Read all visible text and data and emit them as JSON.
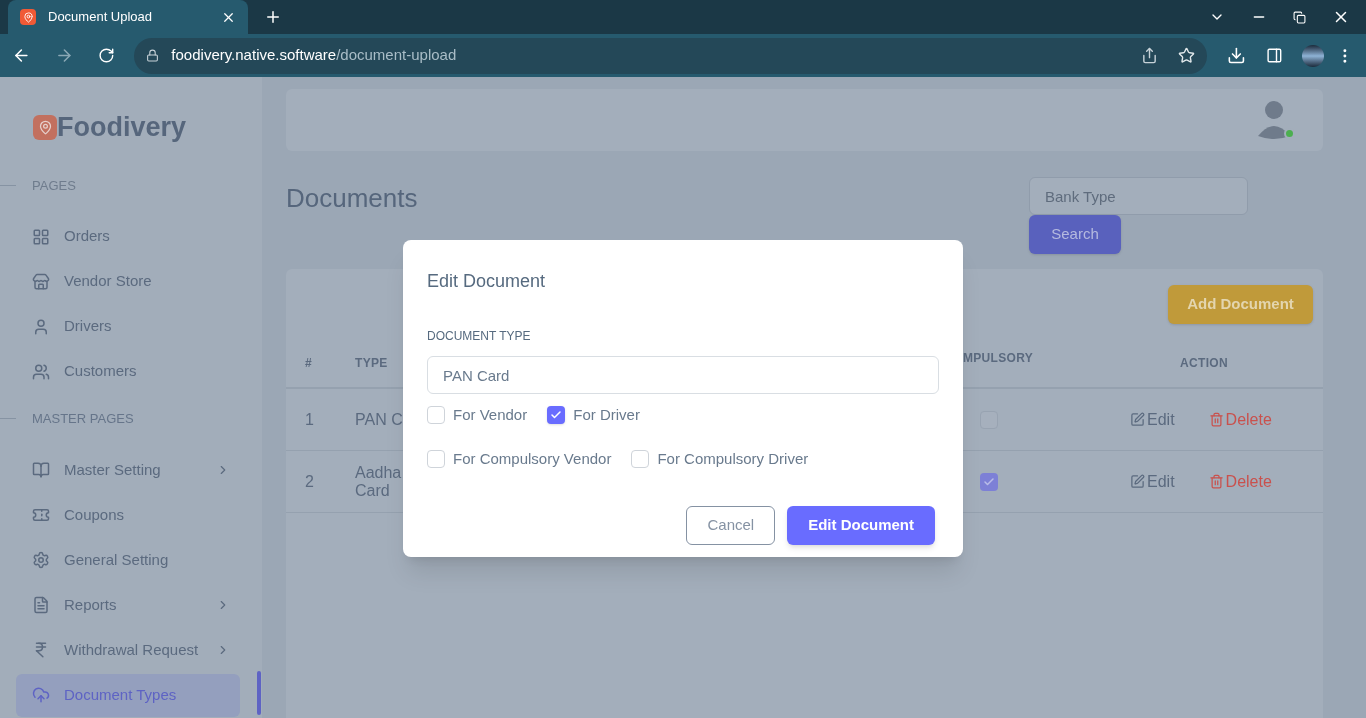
{
  "browser": {
    "tab_title": "Document Upload",
    "url_host": "foodivery.native.software",
    "url_path": "/document-upload"
  },
  "sidebar": {
    "brand": "Foodivery",
    "sections": [
      {
        "heading": "PAGES",
        "items": [
          {
            "label": "Orders",
            "selected": false,
            "expandable": false
          },
          {
            "label": "Vendor Store",
            "selected": false,
            "expandable": false
          },
          {
            "label": "Drivers",
            "selected": false,
            "expandable": false
          },
          {
            "label": "Customers",
            "selected": false,
            "expandable": false
          }
        ]
      },
      {
        "heading": "MASTER PAGES",
        "items": [
          {
            "label": "Master Setting",
            "selected": false,
            "expandable": true
          },
          {
            "label": "Coupons",
            "selected": false,
            "expandable": false
          },
          {
            "label": "General Setting",
            "selected": false,
            "expandable": false
          },
          {
            "label": "Reports",
            "selected": false,
            "expandable": true
          },
          {
            "label": "Withdrawal Request",
            "selected": false,
            "expandable": true
          },
          {
            "label": "Document Types",
            "selected": true,
            "expandable": false
          }
        ]
      }
    ]
  },
  "header": {
    "avatar_online": true
  },
  "page": {
    "title": "Documents",
    "search": {
      "placeholder": "Bank Type",
      "button": "Search"
    },
    "add_button": "Add Document"
  },
  "table": {
    "columns": [
      "#",
      "TYPE",
      "MPULSORY",
      "ACTION"
    ],
    "rows": [
      {
        "number": "1",
        "type": "PAN C",
        "checked": false,
        "actions": [
          "Edit",
          "Delete"
        ]
      },
      {
        "number": "2",
        "type": "Aadha Card",
        "checked": true,
        "actions": [
          "Edit",
          "Delete"
        ]
      }
    ]
  },
  "modal": {
    "title": "Edit Document",
    "field_label": "DOCUMENT TYPE",
    "field_value": "PAN Card",
    "option_rows": [
      [
        {
          "label": "For Vendor",
          "checked": false
        },
        {
          "label": "For Driver",
          "checked": true
        }
      ],
      [
        {
          "label": "For Compulsory Vendor",
          "checked": false
        },
        {
          "label": "For Compulsory Driver",
          "checked": false
        }
      ]
    ],
    "buttons": [
      {
        "label": "Cancel",
        "kind": "secondary"
      },
      {
        "label": "Edit Document",
        "kind": "primary"
      }
    ]
  }
}
